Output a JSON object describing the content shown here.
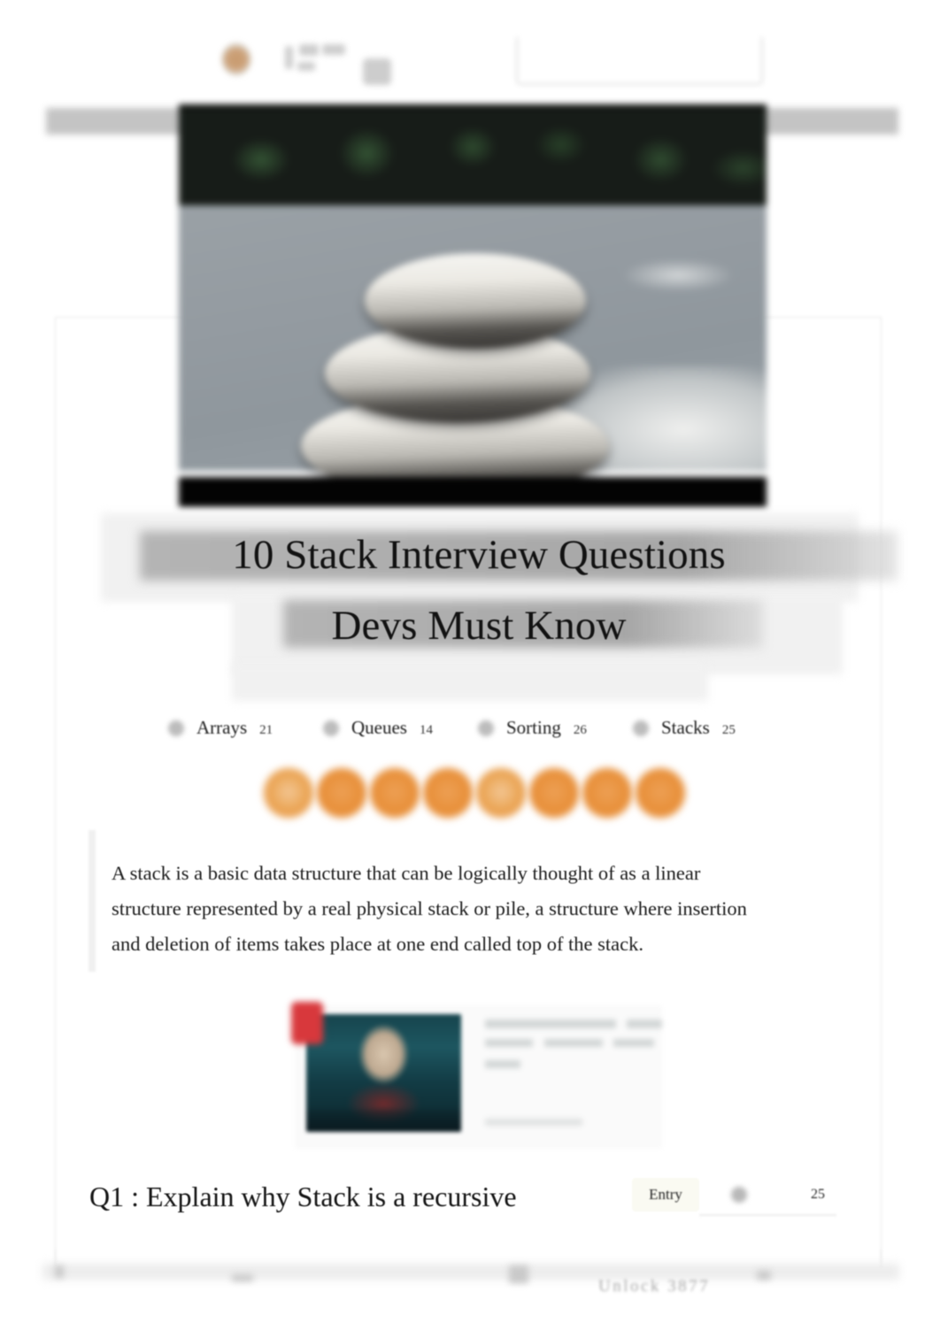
{
  "browser_chrome": {
    "logo_icon": "site-logo-icon",
    "search_box": "blurred-search-field",
    "toolbar_band": "blurred-toolbar-band"
  },
  "hero": {
    "image_alt": "stacked-smooth-stones-photo"
  },
  "article": {
    "title_line_1": "10 Stack Interview Questions",
    "title_line_2": "Devs Must Know",
    "intro_paragraph": "A stack is a basic data structure that can be logically thought of as a linear structure represented by a real physical stack or pile, a structure where insertion and deletion of items takes place at one end called top of the stack."
  },
  "tags": [
    {
      "label": "Arrays",
      "count": "21"
    },
    {
      "label": "Queues",
      "count": "14"
    },
    {
      "label": "Sorting",
      "count": "26"
    },
    {
      "label": "Stacks",
      "count": "25"
    }
  ],
  "progress_orbs": {
    "count": 8,
    "color": "#e8903a",
    "active_index": 4
  },
  "embed": {
    "thumbnail_alt": "video-thumbnail-person-dark-teal",
    "badge_color": "#d8383c"
  },
  "question": {
    "heading": "Q1 : Explain why Stack is a recursive",
    "level_badge": "Entry",
    "count": "25"
  },
  "footer": {
    "label": "Unlock  3877"
  }
}
